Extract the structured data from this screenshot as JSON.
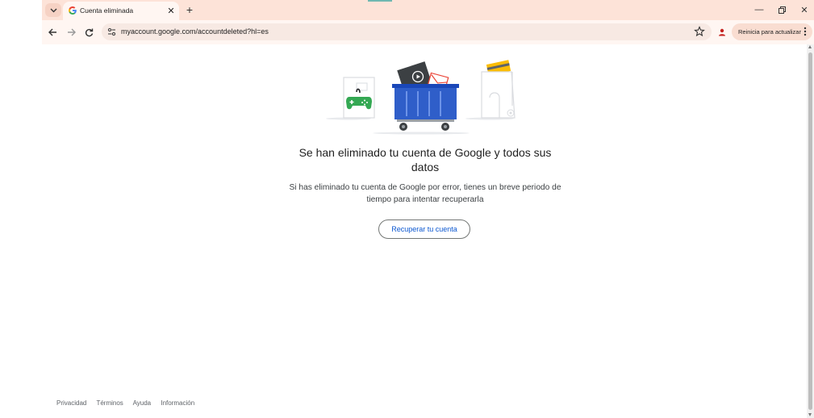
{
  "browser": {
    "tab": {
      "title": "Cuenta eliminada",
      "favicon": "google-g-icon"
    },
    "url": "myaccount.google.com/accountdeleted?hl=es",
    "relaunch_label": "Reinicia para actualizar",
    "colors": {
      "frame": "#fde3d8",
      "toolbar": "#fff6f2",
      "omnibox": "#f7e9e3"
    }
  },
  "page": {
    "heading": "Se han eliminado tu cuenta de Google y todos sus datos",
    "description": "Si has eliminado tu cuenta de Google por error, tienes un breve periodo de tiempo para intentar recuperarla",
    "recover_button": "Recuperar tu cuenta",
    "illustration": "trash-bin-illustration",
    "colors": {
      "bin": "#2f5ec9",
      "gamepad": "#34a853",
      "button_text": "#0b57d0"
    }
  },
  "footer": {
    "links": [
      "Privacidad",
      "Términos",
      "Ayuda",
      "Información"
    ]
  }
}
